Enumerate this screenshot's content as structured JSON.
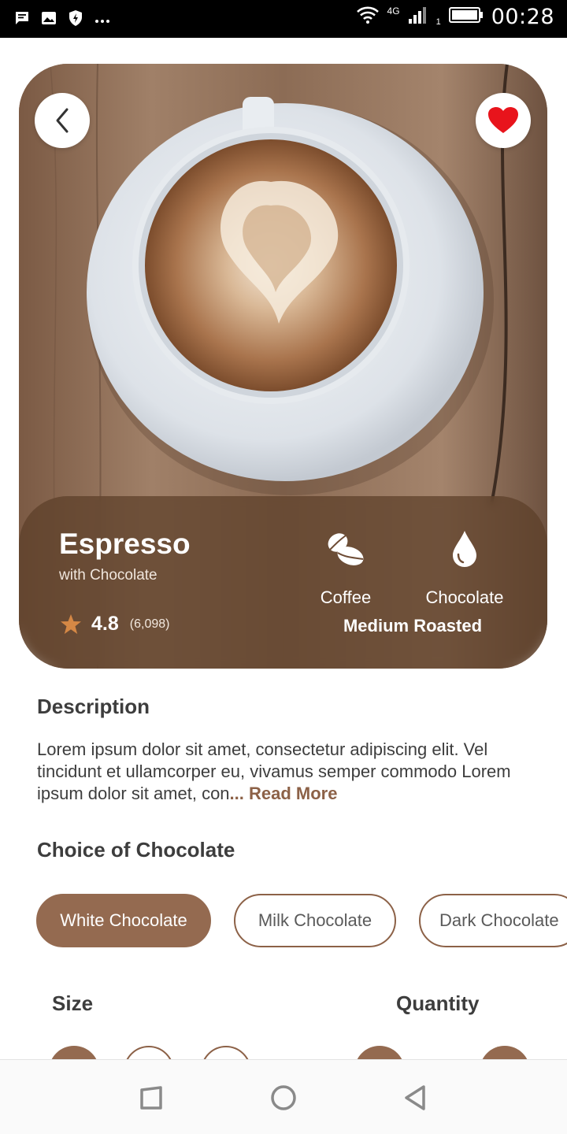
{
  "status_bar": {
    "time": "00:28",
    "network": "4G",
    "sim_index": "1",
    "icons": [
      "message-icon",
      "image-icon",
      "shield-icon",
      "more-icon",
      "wifi-icon",
      "signal-icon",
      "battery-icon"
    ]
  },
  "product": {
    "name": "Espresso",
    "subtitle": "with Chocolate",
    "rating": "4.8",
    "rating_count": "(6,098)",
    "attributes": [
      {
        "label": "Coffee",
        "icon": "coffee-bean-icon"
      },
      {
        "label": "Chocolate",
        "icon": "drop-icon"
      }
    ],
    "roast": "Medium Roasted",
    "favorite": true
  },
  "description": {
    "title": "Description",
    "text": "Lorem ipsum dolor sit amet, consectetur adipiscing elit. Vel tincidunt et ullamcorper eu, vivamus semper commodo Lorem ipsum dolor sit amet, con",
    "more": "... Read More"
  },
  "chocolate_choice": {
    "title": "Choice of Chocolate",
    "options": [
      "White Chocolate",
      "Milk Chocolate",
      "Dark Chocolate"
    ],
    "selected": "White Chocolate"
  },
  "size": {
    "title": "Size"
  },
  "quantity": {
    "title": "Quantity"
  },
  "colors": {
    "accent": "#946a50",
    "accent_text": "#8c6147",
    "heart": "#e8141c"
  }
}
